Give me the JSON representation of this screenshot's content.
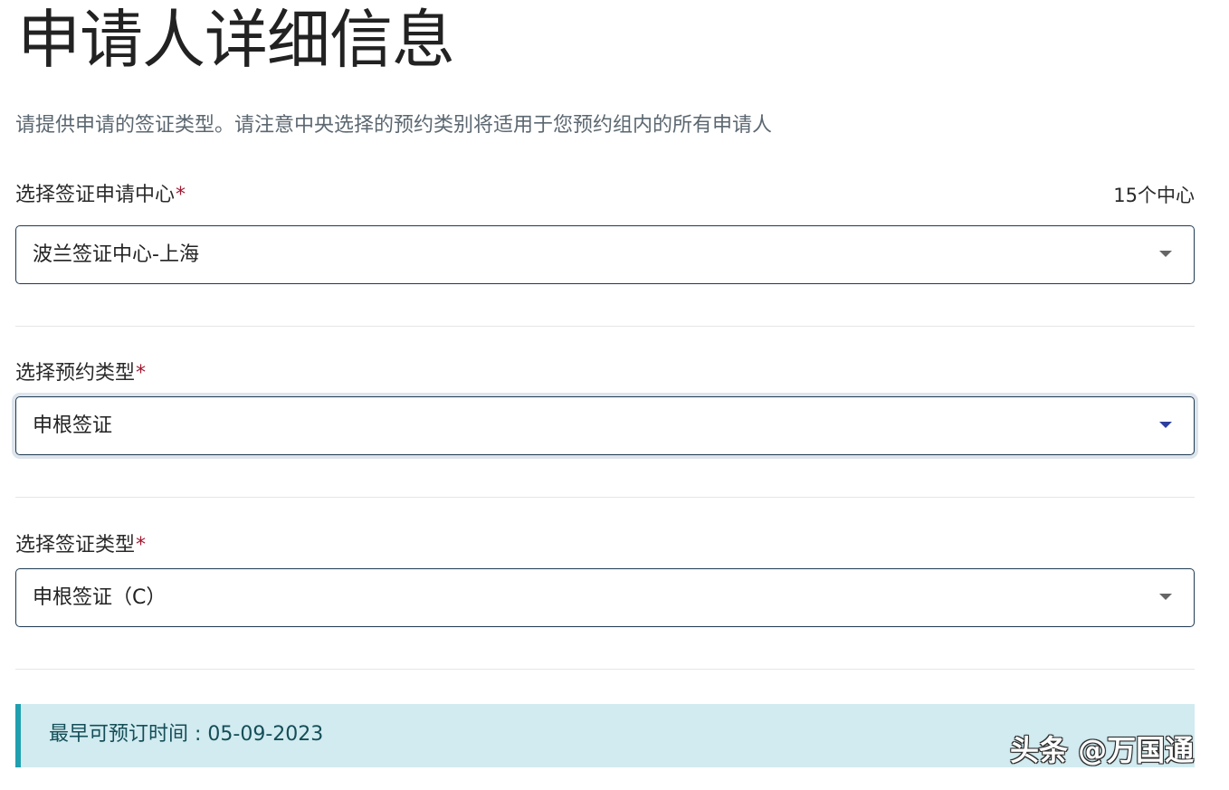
{
  "header": {
    "title": "申请人详细信息",
    "subtitle": "请提供申请的签证类型。请注意中央选择的预约类别将适用于您预约组内的所有申请人"
  },
  "centre_field": {
    "label": "选择签证申请中心",
    "required_mark": "*",
    "count_text": "15个中心",
    "value": "波兰签证中心-上海",
    "icon": "caret-down-icon"
  },
  "category_field": {
    "label": "选择预约类型",
    "required_mark": "*",
    "value": "申根签证",
    "icon": "caret-down-icon",
    "focus_color": "#2c3ea0"
  },
  "subcategory_field": {
    "label": "选择签证类型",
    "required_mark": "*",
    "value": "申根签证（C）",
    "icon": "caret-down-icon"
  },
  "banner": {
    "text": "最早可预订时间 : 05-09-2023",
    "accent_color": "#1f9faf",
    "background_color": "#d1ebf0"
  },
  "watermark": {
    "text": "头条 @万国通"
  },
  "colors": {
    "required": "#a3172f",
    "border": "#1e3a52"
  }
}
